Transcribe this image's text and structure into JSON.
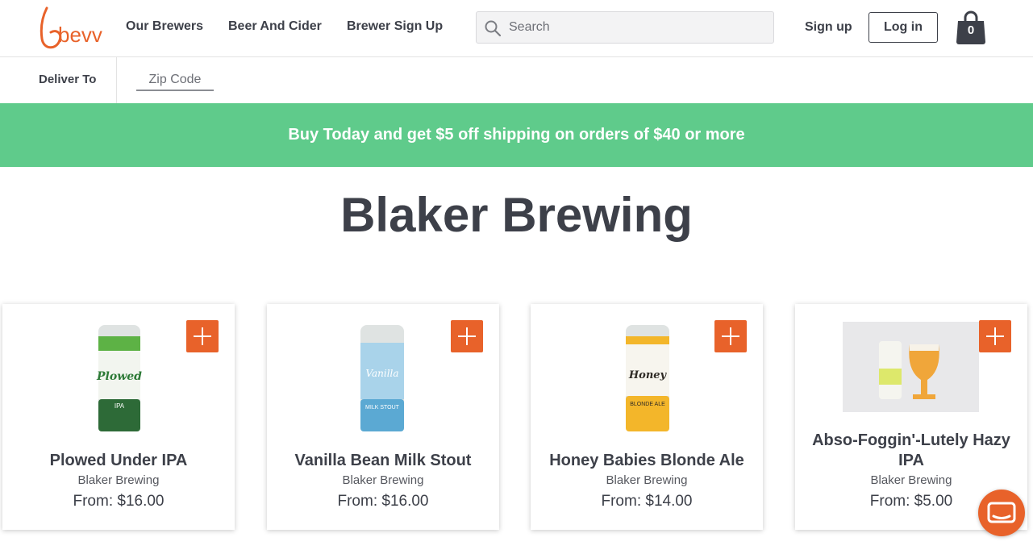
{
  "colors": {
    "brand": "#e8622a",
    "promo": "#5fcb8b",
    "text": "#3d4049"
  },
  "header": {
    "logo_text": "bevv",
    "nav": [
      "Our Brewers",
      "Beer And Cider",
      "Brewer Sign Up"
    ],
    "search_placeholder": "Search",
    "signup_label": "Sign up",
    "login_label": "Log in",
    "cart_count": "0",
    "search_icon": "search-icon",
    "cart_icon": "shopping-bag-icon"
  },
  "deliver": {
    "label": "Deliver To",
    "zip_placeholder": "Zip Code"
  },
  "promo": {
    "text": "Buy Today and get $5 off shipping on orders of $40 or more"
  },
  "page": {
    "title": "Blaker Brewing"
  },
  "products": [
    {
      "name": "Plowed Under IPA",
      "brewer": "Blaker Brewing",
      "price": "From: $16.00",
      "image_icon": "beer-can-image"
    },
    {
      "name": "Vanilla Bean Milk Stout",
      "brewer": "Blaker Brewing",
      "price": "From: $16.00",
      "image_icon": "beer-can-image"
    },
    {
      "name": "Honey Babies Blonde Ale",
      "brewer": "Blaker Brewing",
      "price": "From: $14.00",
      "image_icon": "beer-can-image"
    },
    {
      "name": "Abso-Foggin'-Lutely Hazy IPA",
      "brewer": "Blaker Brewing",
      "price": "From: $5.00",
      "image_icon": "beer-can-and-glass-photo"
    }
  ],
  "chat": {
    "icon": "chat-bubble-icon"
  }
}
